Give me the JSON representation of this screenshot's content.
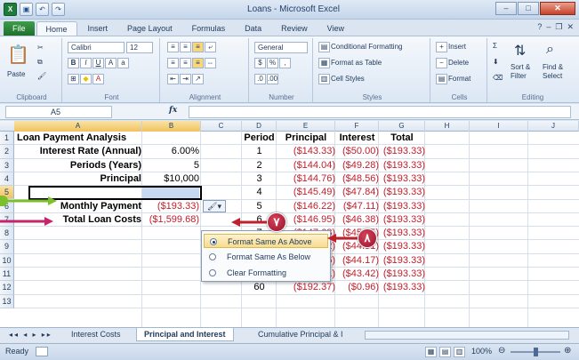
{
  "window": {
    "title": "Loans - Microsoft Excel"
  },
  "qat": {
    "save_icon": "save-icon",
    "undo_icon": "undo-icon",
    "redo_icon": "redo-icon"
  },
  "tabs": [
    "File",
    "Home",
    "Insert",
    "Page Layout",
    "Formulas",
    "Data",
    "Review",
    "View"
  ],
  "ribbon": {
    "clipboard": {
      "label": "Clipboard",
      "paste": "Paste"
    },
    "font": {
      "label": "Font",
      "name": "Calibri",
      "size": "12"
    },
    "alignment": {
      "label": "Alignment"
    },
    "number": {
      "label": "Number",
      "format": "General"
    },
    "styles": {
      "label": "Styles",
      "conditional": "Conditional Formatting",
      "table": "Format as Table",
      "cell_styles": "Cell Styles"
    },
    "cells": {
      "label": "Cells",
      "insert": "Insert",
      "delete": "Delete",
      "format": "Format"
    },
    "editing": {
      "label": "Editing",
      "sort": "Sort &",
      "sort2": "Filter",
      "find": "Find &",
      "find2": "Select"
    }
  },
  "namebox": "A5",
  "fx": "fx",
  "columns": [
    "A",
    "B",
    "C",
    "D",
    "E",
    "F",
    "G",
    "H",
    "I",
    "J"
  ],
  "rows": [
    "1",
    "2",
    "3",
    "4",
    "5",
    "6",
    "7",
    "8",
    "9",
    "10",
    "11",
    "12",
    "13"
  ],
  "left_table": {
    "title": "Loan Payment Analysis",
    "rate_label": "Interest Rate (Annual)",
    "rate": "6.00%",
    "periods_label": "Periods (Years)",
    "periods": "5",
    "principal_label": "Principal",
    "principal": "$10,000",
    "payment_label": "Monthly Payment",
    "payment": "($193.33)",
    "total_label": "Total Loan Costs",
    "total": "($1,599.68)"
  },
  "right_table": {
    "headers": [
      "Period",
      "Principal",
      "Interest",
      "Total"
    ],
    "rows": [
      [
        "1",
        "($143.33)",
        "($50.00)",
        "($193.33)"
      ],
      [
        "2",
        "($144.04)",
        "($49.28)",
        "($193.33)"
      ],
      [
        "3",
        "($144.76)",
        "($48.56)",
        "($193.33)"
      ],
      [
        "4",
        "($145.49)",
        "($47.84)",
        "($193.33)"
      ],
      [
        "5",
        "($146.22)",
        "($47.11)",
        "($193.33)"
      ],
      [
        "6",
        "($146.95)",
        "($46.38)",
        "($193.33)"
      ],
      [
        "7",
        "($147.68)",
        "($45.65)",
        "($193.33)"
      ],
      [
        "8",
        "($148.42)",
        "($44.91)",
        "($193.33)"
      ],
      [
        "9",
        "($149.16)",
        "($44.17)",
        "($193.33)"
      ],
      [
        "10",
        "($149.91)",
        "($43.42)",
        "($193.33)"
      ],
      [
        "60",
        "($192.37)",
        "($0.96)",
        "($193.33)"
      ]
    ]
  },
  "context_menu": {
    "items": [
      "Format Same As Above",
      "Format Same As Below",
      "Clear Formatting"
    ],
    "selected": 0
  },
  "sheet_tabs": [
    "Interest Costs",
    "Principal and Interest",
    "Cumulative Principal & I"
  ],
  "status": {
    "ready": "Ready",
    "zoom": "100%"
  },
  "badges": {
    "seven": "٧",
    "eight": "٨"
  }
}
